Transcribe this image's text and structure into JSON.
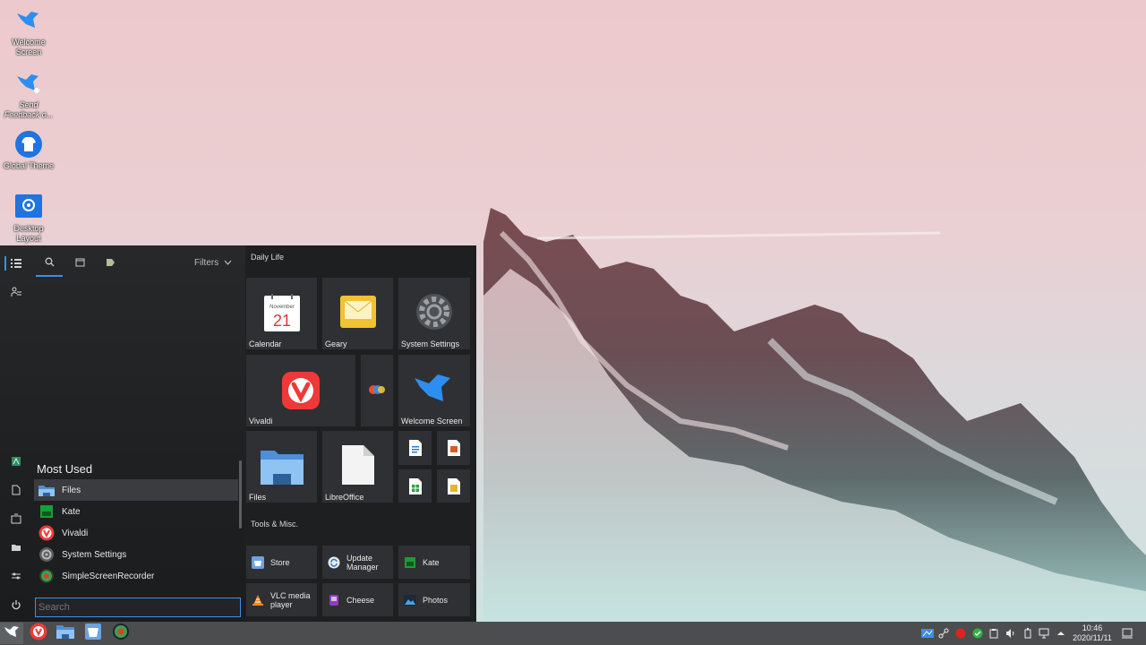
{
  "desktop": {
    "icons": [
      {
        "label": "Welcome Screen",
        "icon": "bird-icon"
      },
      {
        "label": "Send Feedback o...",
        "icon": "bird-feedback-icon"
      },
      {
        "label": "Global Theme",
        "icon": "shirt-icon"
      },
      {
        "label": "Desktop Layout",
        "icon": "layout-icon"
      }
    ]
  },
  "menu": {
    "filters_label": "Filters",
    "tabs": [
      "list-icon",
      "search-icon",
      "calendar-icon",
      "tag-icon"
    ],
    "most_used": {
      "title": "Most Used",
      "items": [
        {
          "label": "Files",
          "icon": "folder-icon"
        },
        {
          "label": "Kate",
          "icon": "kate-icon"
        },
        {
          "label": "Vivaldi",
          "icon": "vivaldi-icon"
        },
        {
          "label": "System Settings",
          "icon": "gear-icon"
        },
        {
          "label": "SimpleScreenRecorder",
          "icon": "recorder-icon"
        }
      ]
    },
    "search_placeholder": "Search",
    "sections": {
      "daily_life": "Daily Life",
      "tools": "Tools & Misc."
    },
    "tiles": {
      "calendar": {
        "label": "Calendar",
        "month": "November",
        "day": "21"
      },
      "geary": {
        "label": "Geary"
      },
      "system_settings": {
        "label": "System Settings"
      },
      "vivaldi": {
        "label": "Vivaldi"
      },
      "welcome": {
        "label": "Welcome Screen"
      },
      "files": {
        "label": "Files"
      },
      "libreoffice": {
        "label": "LibreOffice"
      }
    },
    "small_tiles": [
      {
        "label": "Store",
        "icon": "store-icon"
      },
      {
        "label": "Update Manager",
        "icon": "update-icon"
      },
      {
        "label": "Kate",
        "icon": "kate-icon"
      },
      {
        "label": "VLC media player",
        "icon": "vlc-icon"
      },
      {
        "label": "Cheese",
        "icon": "cheese-icon"
      },
      {
        "label": "Photos",
        "icon": "photos-icon"
      }
    ]
  },
  "taskbar": {
    "clock_time": "10:46",
    "clock_date": "2020/11/11",
    "pinned": [
      "start-icon",
      "vivaldi-icon",
      "folder-icon",
      "store-icon",
      "recorder-icon"
    ]
  },
  "colors": {
    "accent": "#3d8ee8",
    "vivaldi": "#ef3939",
    "menu_bg": "#1e1f20",
    "tile_bg": "#2f3033"
  }
}
